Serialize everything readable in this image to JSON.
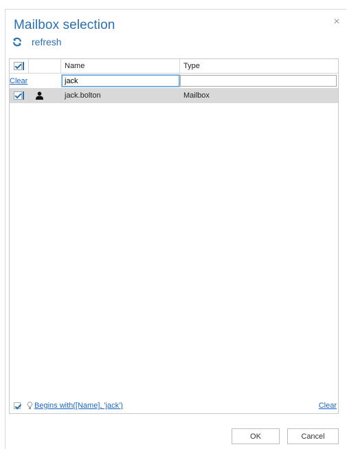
{
  "dialog": {
    "title": "Mailbox selection",
    "close_glyph": "×"
  },
  "toolbar": {
    "refresh_label": "refresh",
    "refresh_icon": "refresh-icon"
  },
  "grid": {
    "columns": [
      "",
      "",
      "Name",
      "Type"
    ],
    "filter": {
      "clear_label": "Clear",
      "name_value": "jack",
      "type_value": ""
    },
    "rows": [
      {
        "checked": true,
        "icon": "user-icon",
        "name": "jack.bolton",
        "type": "Mailbox"
      }
    ]
  },
  "footer": {
    "filter_expression": "Begins with([Name], 'jack')",
    "clear_label": "Clear"
  },
  "buttons": {
    "ok_label": "OK",
    "cancel_label": "Cancel"
  },
  "colors": {
    "accent": "#2a6fb0",
    "link": "#1a66c6",
    "selected_row": "#d9d9d9"
  }
}
